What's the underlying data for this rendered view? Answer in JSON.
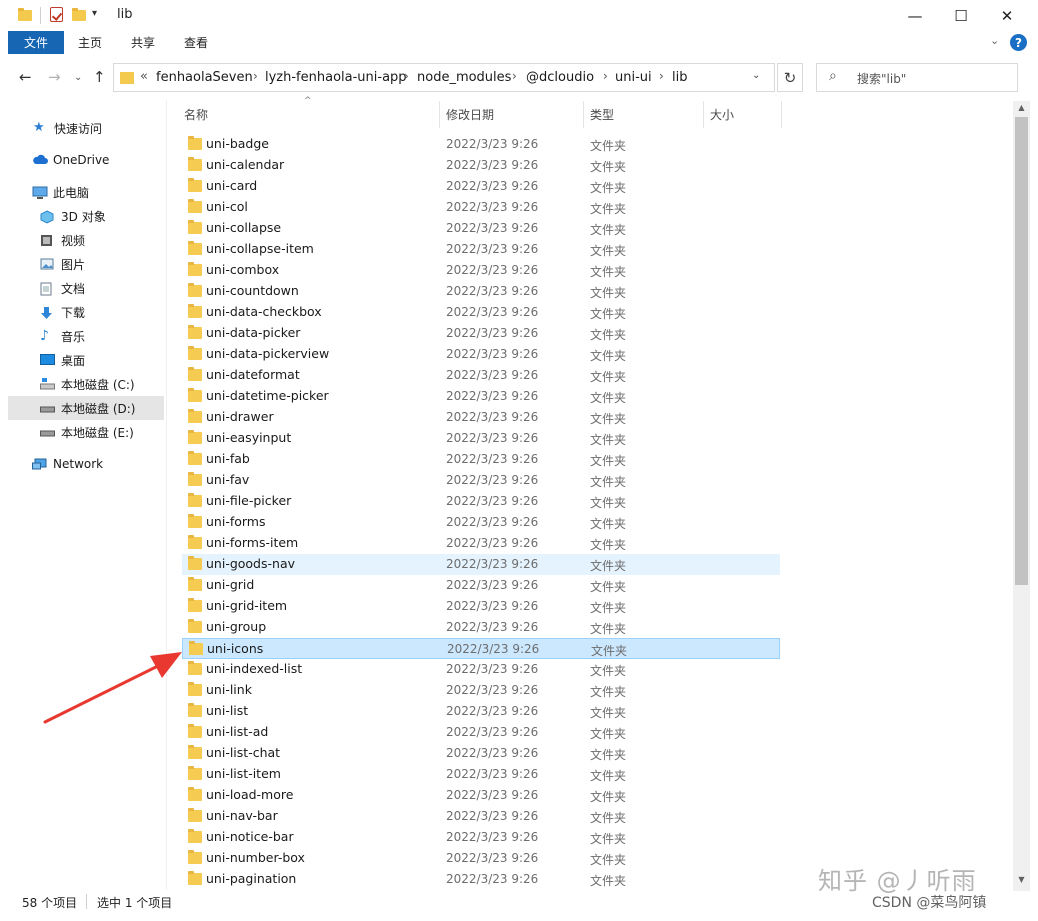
{
  "window": {
    "title": "lib",
    "controls": {
      "minimize": "—",
      "maximize": "☐",
      "close": "✕"
    }
  },
  "ribbon": {
    "tabs": [
      "文件",
      "主页",
      "共享",
      "查看"
    ],
    "help": "?"
  },
  "address_bar": {
    "overflow": "«",
    "path": [
      "fenhaolaSeven",
      "lyzh-fenhaola-uni-app",
      "node_modules",
      "@dcloudio",
      "uni-ui",
      "lib"
    ],
    "separator": "›"
  },
  "search": {
    "placeholder": "搜索\"lib\""
  },
  "nav_pane": {
    "items": [
      {
        "label": "快速访问",
        "icon": "star-icon"
      },
      {
        "label": "OneDrive",
        "icon": "cloud-icon"
      },
      {
        "label": "此电脑",
        "icon": "computer-icon"
      },
      {
        "label": "3D 对象",
        "icon": "cube-icon"
      },
      {
        "label": "视频",
        "icon": "video-icon"
      },
      {
        "label": "图片",
        "icon": "picture-icon"
      },
      {
        "label": "文档",
        "icon": "document-icon"
      },
      {
        "label": "下载",
        "icon": "download-icon"
      },
      {
        "label": "音乐",
        "icon": "music-icon"
      },
      {
        "label": "桌面",
        "icon": "desktop-icon"
      },
      {
        "label": "本地磁盘 (C:)",
        "icon": "drive-c-icon"
      },
      {
        "label": "本地磁盘 (D:)",
        "icon": "drive-icon",
        "selected": true
      },
      {
        "label": "本地磁盘 (E:)",
        "icon": "drive-icon"
      },
      {
        "label": "Network",
        "icon": "network-icon"
      }
    ]
  },
  "columns": {
    "name": "名称",
    "date": "修改日期",
    "type": "类型",
    "size": "大小"
  },
  "files": [
    {
      "name": "uni-badge",
      "date": "2022/3/23 9:26",
      "type": "文件夹"
    },
    {
      "name": "uni-calendar",
      "date": "2022/3/23 9:26",
      "type": "文件夹"
    },
    {
      "name": "uni-card",
      "date": "2022/3/23 9:26",
      "type": "文件夹"
    },
    {
      "name": "uni-col",
      "date": "2022/3/23 9:26",
      "type": "文件夹"
    },
    {
      "name": "uni-collapse",
      "date": "2022/3/23 9:26",
      "type": "文件夹"
    },
    {
      "name": "uni-collapse-item",
      "date": "2022/3/23 9:26",
      "type": "文件夹"
    },
    {
      "name": "uni-combox",
      "date": "2022/3/23 9:26",
      "type": "文件夹"
    },
    {
      "name": "uni-countdown",
      "date": "2022/3/23 9:26",
      "type": "文件夹"
    },
    {
      "name": "uni-data-checkbox",
      "date": "2022/3/23 9:26",
      "type": "文件夹"
    },
    {
      "name": "uni-data-picker",
      "date": "2022/3/23 9:26",
      "type": "文件夹"
    },
    {
      "name": "uni-data-pickerview",
      "date": "2022/3/23 9:26",
      "type": "文件夹"
    },
    {
      "name": "uni-dateformat",
      "date": "2022/3/23 9:26",
      "type": "文件夹"
    },
    {
      "name": "uni-datetime-picker",
      "date": "2022/3/23 9:26",
      "type": "文件夹"
    },
    {
      "name": "uni-drawer",
      "date": "2022/3/23 9:26",
      "type": "文件夹"
    },
    {
      "name": "uni-easyinput",
      "date": "2022/3/23 9:26",
      "type": "文件夹"
    },
    {
      "name": "uni-fab",
      "date": "2022/3/23 9:26",
      "type": "文件夹"
    },
    {
      "name": "uni-fav",
      "date": "2022/3/23 9:26",
      "type": "文件夹"
    },
    {
      "name": "uni-file-picker",
      "date": "2022/3/23 9:26",
      "type": "文件夹"
    },
    {
      "name": "uni-forms",
      "date": "2022/3/23 9:26",
      "type": "文件夹"
    },
    {
      "name": "uni-forms-item",
      "date": "2022/3/23 9:26",
      "type": "文件夹"
    },
    {
      "name": "uni-goods-nav",
      "date": "2022/3/23 9:26",
      "type": "文件夹",
      "hover": true
    },
    {
      "name": "uni-grid",
      "date": "2022/3/23 9:26",
      "type": "文件夹"
    },
    {
      "name": "uni-grid-item",
      "date": "2022/3/23 9:26",
      "type": "文件夹"
    },
    {
      "name": "uni-group",
      "date": "2022/3/23 9:26",
      "type": "文件夹"
    },
    {
      "name": "uni-icons",
      "date": "2022/3/23 9:26",
      "type": "文件夹",
      "selected": true
    },
    {
      "name": "uni-indexed-list",
      "date": "2022/3/23 9:26",
      "type": "文件夹"
    },
    {
      "name": "uni-link",
      "date": "2022/3/23 9:26",
      "type": "文件夹"
    },
    {
      "name": "uni-list",
      "date": "2022/3/23 9:26",
      "type": "文件夹"
    },
    {
      "name": "uni-list-ad",
      "date": "2022/3/23 9:26",
      "type": "文件夹"
    },
    {
      "name": "uni-list-chat",
      "date": "2022/3/23 9:26",
      "type": "文件夹"
    },
    {
      "name": "uni-list-item",
      "date": "2022/3/23 9:26",
      "type": "文件夹"
    },
    {
      "name": "uni-load-more",
      "date": "2022/3/23 9:26",
      "type": "文件夹"
    },
    {
      "name": "uni-nav-bar",
      "date": "2022/3/23 9:26",
      "type": "文件夹"
    },
    {
      "name": "uni-notice-bar",
      "date": "2022/3/23 9:26",
      "type": "文件夹"
    },
    {
      "name": "uni-number-box",
      "date": "2022/3/23 9:26",
      "type": "文件夹"
    },
    {
      "name": "uni-pagination",
      "date": "2022/3/23 9:26",
      "type": "文件夹"
    }
  ],
  "status": {
    "count": "58 个项目",
    "selection": "选中 1 个项目"
  },
  "watermarks": {
    "zhihu": "知乎 @丿听雨",
    "csdn": "CSDN @菜鸟阿镇"
  },
  "colors": {
    "accent": "#1766b3",
    "selected_row": "#cce8ff",
    "hover_row": "#e5f3ff",
    "folder": "#f5cb51",
    "arrow": "#e8382f"
  }
}
